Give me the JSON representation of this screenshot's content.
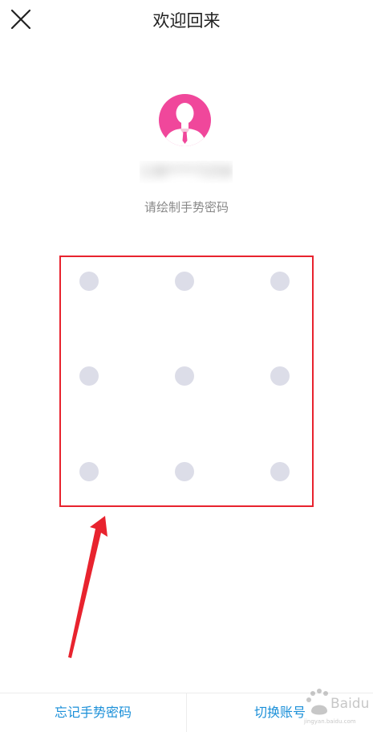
{
  "header": {
    "title": "欢迎回来",
    "close_icon": "close-icon"
  },
  "profile": {
    "avatar_icon": "user-avatar-icon",
    "username": "138****7258",
    "hint": "请绘制手势密码"
  },
  "pattern": {
    "rows": 3,
    "cols": 3,
    "dot_color": "#dcdde8"
  },
  "annotation": {
    "box_color": "#e8232e",
    "arrow_color": "#e8232e"
  },
  "footer": {
    "forgot_label": "忘记手势密码",
    "switch_label": "切换账号",
    "link_color": "#1a8fd8"
  },
  "watermark": {
    "text": "Baidu 经验",
    "subtext": "jingyan.baidu.com"
  }
}
